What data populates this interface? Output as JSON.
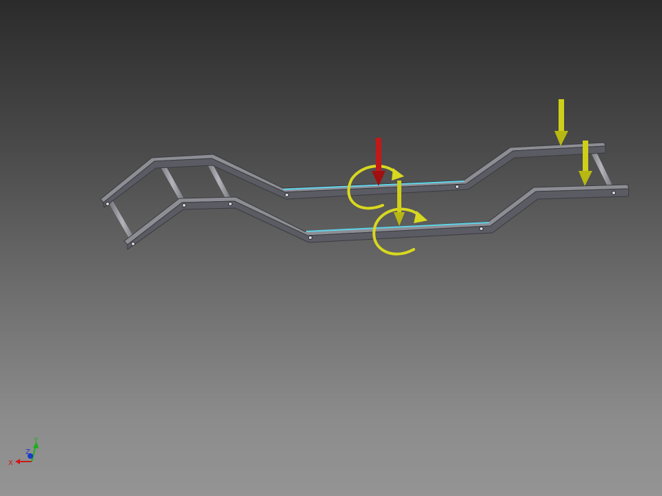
{
  "colors": {
    "frame_top": "#8f8f96",
    "frame_side": "#5a5a62",
    "frame_edge": "#3a3a40",
    "tube": "#9a9aa2",
    "highlight_edge": "#5fd4e8",
    "load_primary": "#c41818",
    "load_secondary": "#cfcf1a",
    "moment": "#d8d820",
    "axis_x": "#cc1a1a",
    "axis_y": "#1ab01a",
    "axis_z": "#1a3acc"
  },
  "triad": {
    "x_label": "X",
    "y_label": "Y",
    "z_label": "Z"
  }
}
